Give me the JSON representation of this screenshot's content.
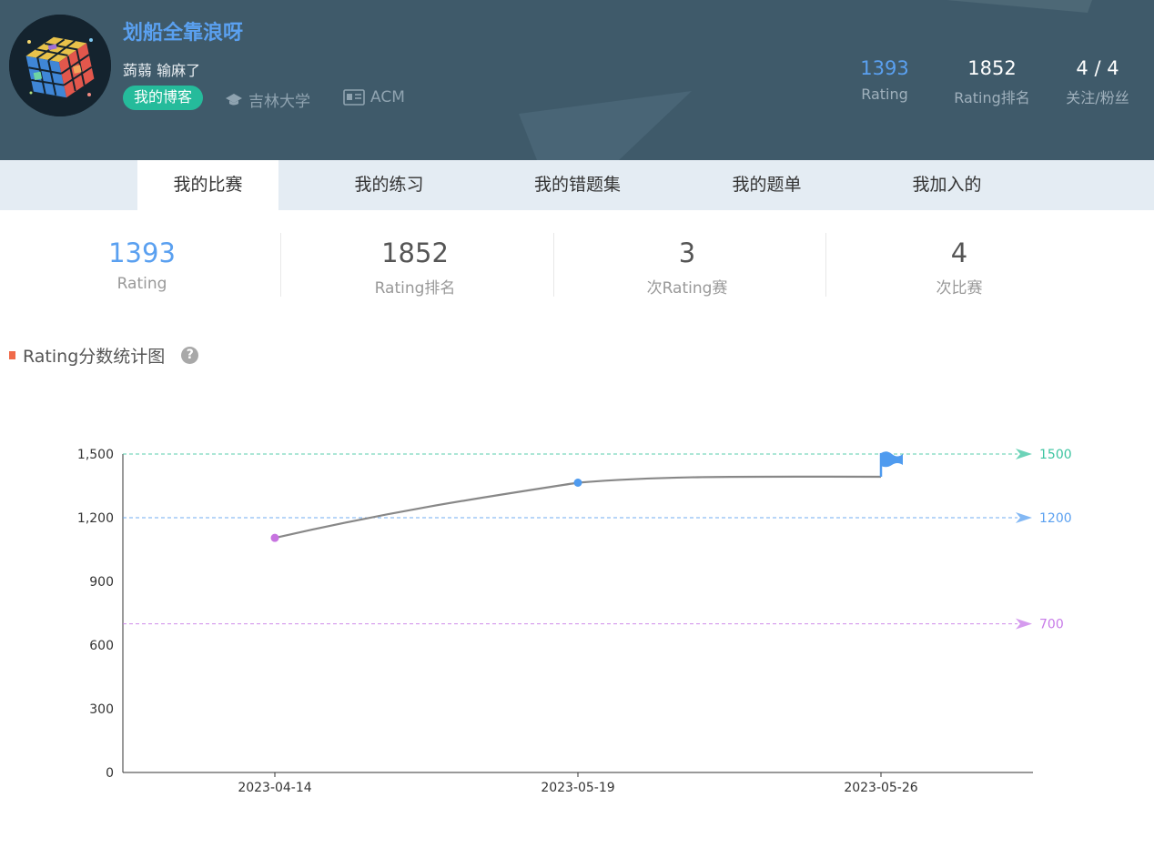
{
  "profile": {
    "username": "划船全靠浪呀",
    "signature": "蒟蒻 输麻了",
    "blog_button": "我的博客",
    "school": "吉林大学",
    "org": "ACM"
  },
  "header_stats": {
    "rating": {
      "value": "1393",
      "label": "Rating"
    },
    "rank": {
      "value": "1852",
      "label": "Rating排名"
    },
    "follow": {
      "value": "4 / 4",
      "label": "关注/粉丝"
    }
  },
  "tabs": [
    "我的比赛",
    "我的练习",
    "我的错题集",
    "我的题单",
    "我加入的"
  ],
  "stats": [
    {
      "value": "1393",
      "label": "Rating"
    },
    {
      "value": "1852",
      "label": "Rating排名"
    },
    {
      "value": "3",
      "label": "次Rating赛"
    },
    {
      "value": "4",
      "label": "次比赛"
    }
  ],
  "chart_title": "Rating分数统计图",
  "colors": {
    "header_bg": "#3f5a6a",
    "accent_blue": "#5aa0f0",
    "blog_green": "#25bb9b",
    "title_mark": "#f06a4a"
  },
  "chart_data": {
    "type": "line",
    "title": "Rating分数统计图",
    "x": [
      "2023-04-14",
      "2023-05-19",
      "2023-05-26"
    ],
    "series": [
      {
        "values": [
          1105,
          1365,
          1393
        ],
        "color": "#888888"
      }
    ],
    "point_colors": [
      "#c774e0",
      "#4f9bef",
      "#4f9bef"
    ],
    "last_point_marker": "flag-icon",
    "ylim": [
      0,
      1500
    ],
    "yticks": [
      "0",
      "300",
      "600",
      "900",
      "1,200",
      "1,500"
    ],
    "ytick_values": [
      0,
      300,
      600,
      900,
      1200,
      1500
    ],
    "reference_lines": [
      {
        "value": 1500,
        "label": "1500",
        "color": "#3cc4a0"
      },
      {
        "value": 1200,
        "label": "1200",
        "color": "#5aa0f0"
      },
      {
        "value": 700,
        "label": "700",
        "color": "#c77ae8"
      }
    ],
    "xlabel": "",
    "ylabel": "",
    "grid": false
  }
}
